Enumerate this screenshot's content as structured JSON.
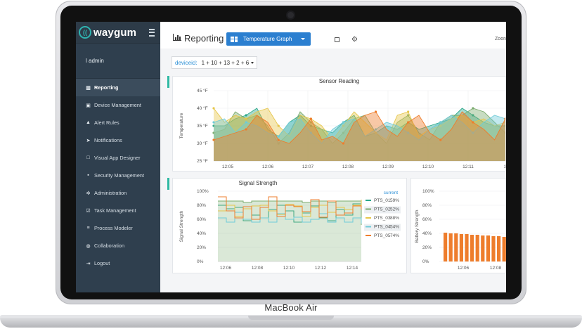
{
  "device": {
    "brand": "MacBook Air"
  },
  "app": {
    "logo": "waygum"
  },
  "sidebar": {
    "user": "l admin",
    "items": [
      {
        "label": "Reporting",
        "icon": "bar-chart-icon",
        "active": true
      },
      {
        "label": "Device Management",
        "icon": "device-icon"
      },
      {
        "label": "Alert Rules",
        "icon": "bell-icon"
      },
      {
        "label": "Notifications",
        "icon": "paper-plane-icon"
      },
      {
        "label": "Visual App Designer",
        "icon": "square-icon"
      },
      {
        "label": "Security Management",
        "icon": "lock-icon"
      },
      {
        "label": "Administration",
        "icon": "cogs-icon"
      },
      {
        "label": "Task Management",
        "icon": "check-square-icon"
      },
      {
        "label": "Process Modeler",
        "icon": "list-icon"
      },
      {
        "label": "Collaboration",
        "icon": "chat-icon"
      },
      {
        "label": "Logout",
        "icon": "logout-icon"
      }
    ]
  },
  "header": {
    "title": "Reporting",
    "graph_button": "Temperature Graph",
    "zoom_label": "Zoon"
  },
  "filter": {
    "key": "deviceid:",
    "value": "1 + 10 + 13 + 2 + 6"
  },
  "colors": {
    "PTS_01": "#2aa88a",
    "PTS_02": "#7bab6e",
    "PTS_03": "#e6c64a",
    "PTS_04": "#6fcbd8",
    "PTS_05": "#ee7d2c",
    "accent": "#2fb9a3",
    "button": "#2b7fd0"
  },
  "chart_data": [
    {
      "type": "area",
      "title": "Sensor Reading",
      "ylabel": "Temperature",
      "ylim": [
        25,
        45
      ],
      "yticks": [
        "45 °F",
        "40 °F",
        "35 °F",
        "30 °F",
        "25 °F"
      ],
      "xticks": [
        "12:05",
        "12:06",
        "12:07",
        "12:08",
        "12:09",
        "12:10",
        "12:11",
        "12:1"
      ],
      "series": [
        {
          "key": "PTS_01",
          "values": [
            35,
            35,
            37,
            38,
            40,
            34,
            32,
            36,
            38,
            35,
            34,
            33,
            36,
            38,
            32,
            33,
            35,
            34,
            36,
            34,
            35,
            36,
            37,
            40,
            38,
            36,
            35,
            35
          ]
        },
        {
          "key": "PTS_02",
          "values": [
            33,
            34,
            39,
            37,
            38,
            35,
            30,
            33,
            39,
            36,
            34,
            30,
            33,
            37,
            38,
            33,
            30,
            36,
            38,
            33,
            31,
            36,
            38,
            38,
            40,
            39,
            36,
            33
          ]
        },
        {
          "key": "PTS_03",
          "values": [
            40,
            36,
            38,
            37,
            39,
            40,
            35,
            32,
            38,
            37,
            35,
            31,
            35,
            39,
            36,
            33,
            31,
            38,
            39,
            32,
            34,
            35,
            37,
            38,
            36,
            37,
            35,
            36
          ]
        },
        {
          "key": "PTS_04",
          "values": [
            36,
            37,
            33,
            36,
            35,
            33,
            32,
            36,
            37,
            33,
            30,
            34,
            36,
            37,
            32,
            34,
            36,
            35,
            33,
            31,
            34,
            36,
            38,
            36,
            33,
            36,
            38,
            37
          ]
        },
        {
          "key": "PTS_05",
          "values": [
            31,
            32,
            33,
            34,
            38,
            36,
            31,
            30,
            33,
            37,
            31,
            32,
            30,
            36,
            38,
            39,
            34,
            32,
            36,
            38,
            33,
            31,
            34,
            39,
            36,
            34,
            31,
            37
          ]
        }
      ]
    },
    {
      "type": "line",
      "title": "Signal Strength",
      "ylabel": "Signal Strength",
      "ylim": [
        0,
        100
      ],
      "yticks": [
        "100%",
        "80%",
        "60%",
        "40%",
        "20%",
        "0%"
      ],
      "xticks": [
        "12:06",
        "12:08",
        "12:10",
        "12:12",
        "12:14"
      ],
      "legend_header": "current",
      "series": [
        {
          "name": "PTS_01",
          "current": "59%",
          "values": [
            80,
            75,
            77,
            58,
            66,
            62,
            74,
            80,
            72,
            56,
            69,
            79,
            62,
            58,
            74,
            66,
            82,
            59
          ]
        },
        {
          "name": "PTS_02",
          "current": "52%",
          "values": [
            86,
            86,
            86,
            84,
            86,
            86,
            86,
            86,
            86,
            86,
            84,
            86,
            86,
            84,
            86,
            86,
            86,
            52
          ]
        },
        {
          "name": "PTS_03",
          "current": "88%",
          "values": [
            72,
            80,
            64,
            75,
            79,
            80,
            72,
            67,
            81,
            79,
            64,
            77,
            80,
            70,
            77,
            74,
            80,
            88
          ]
        },
        {
          "name": "PTS_04",
          "current": "54%",
          "values": [
            62,
            56,
            70,
            60,
            56,
            62,
            56,
            68,
            60,
            63,
            56,
            60,
            68,
            56,
            62,
            56,
            62,
            54
          ]
        },
        {
          "name": "PTS_05",
          "current": "74%",
          "values": [
            92,
            72,
            62,
            78,
            60,
            77,
            92,
            64,
            80,
            78,
            71,
            88,
            63,
            86,
            66,
            69,
            79,
            74
          ]
        }
      ]
    },
    {
      "type": "bar",
      "ylabel": "Battery Strength",
      "ylim": [
        0,
        100
      ],
      "yticks": [
        "100%",
        "80%",
        "60%",
        "40%",
        "20%",
        "0%"
      ],
      "xticks": [
        "12:06",
        "12:08"
      ],
      "values": [
        41,
        40,
        40,
        39,
        39,
        38,
        38,
        37,
        37,
        36,
        36,
        35,
        35
      ]
    }
  ]
}
